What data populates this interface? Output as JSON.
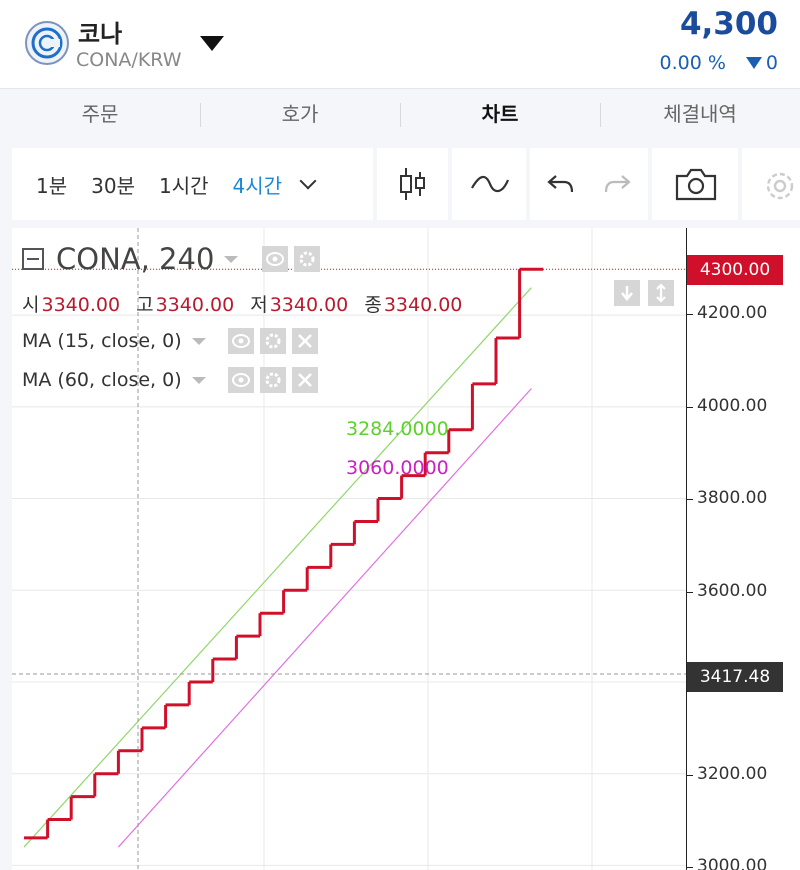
{
  "header": {
    "coin_name": "코나",
    "pair": "CONA/KRW",
    "price": "4,300",
    "change_pct": "0.00 %",
    "change_abs": "0"
  },
  "tabs": [
    {
      "label": "주문"
    },
    {
      "label": "호가"
    },
    {
      "label": "차트"
    },
    {
      "label": "체결내역"
    }
  ],
  "toolbar": {
    "timeframes": [
      "1분",
      "30분",
      "1시간",
      "4시간"
    ],
    "active_timeframe": "4시간"
  },
  "legend": {
    "symbol": "CONA, 240",
    "ohlc": [
      {
        "label": "시",
        "value": "3340.00"
      },
      {
        "label": "고",
        "value": "3340.00"
      },
      {
        "label": "저",
        "value": "3340.00"
      },
      {
        "label": "종",
        "value": "3340.00"
      }
    ],
    "ma15": {
      "label": "MA (15, close, 0)",
      "value": "3284.0000"
    },
    "ma60": {
      "label": "MA (60, close, 0)",
      "value": "3060.0000"
    }
  },
  "axis": {
    "ticks": [
      "4200.00",
      "4000.00",
      "3800.00",
      "3600.00",
      "3200.00",
      "3000.00"
    ],
    "current_price_tag": "4300.00",
    "crosshair_price_tag": "3417.48"
  },
  "colors": {
    "candle": "#d0102a",
    "ma15": "#8fd86a",
    "ma60": "#e070e0",
    "price_blue": "#1a4b9c",
    "accent": "#1e88d6"
  },
  "chart_data": {
    "type": "line",
    "series": [
      {
        "name": "CONA, 240",
        "x": [
          1,
          2,
          3,
          4,
          5,
          6,
          7,
          8,
          9,
          10,
          11,
          12,
          13,
          14,
          15,
          16,
          17,
          18,
          19,
          20,
          21
        ],
        "values": [
          3060,
          3100,
          3150,
          3200,
          3250,
          3300,
          3350,
          3400,
          3450,
          3500,
          3550,
          3600,
          3650,
          3700,
          3750,
          3800,
          3850,
          3900,
          3950,
          4050,
          4150
        ]
      },
      {
        "name": "MA (15, close, 0)",
        "x": [
          0,
          21.5
        ],
        "values": [
          3040,
          4260
        ]
      },
      {
        "name": "MA (60, close, 0)",
        "x": [
          4,
          21.5
        ],
        "values": [
          3040,
          4040
        ]
      }
    ],
    "last": {
      "x": 22,
      "value": 4300
    },
    "ylim": [
      2990,
      4390
    ],
    "grid": true
  }
}
